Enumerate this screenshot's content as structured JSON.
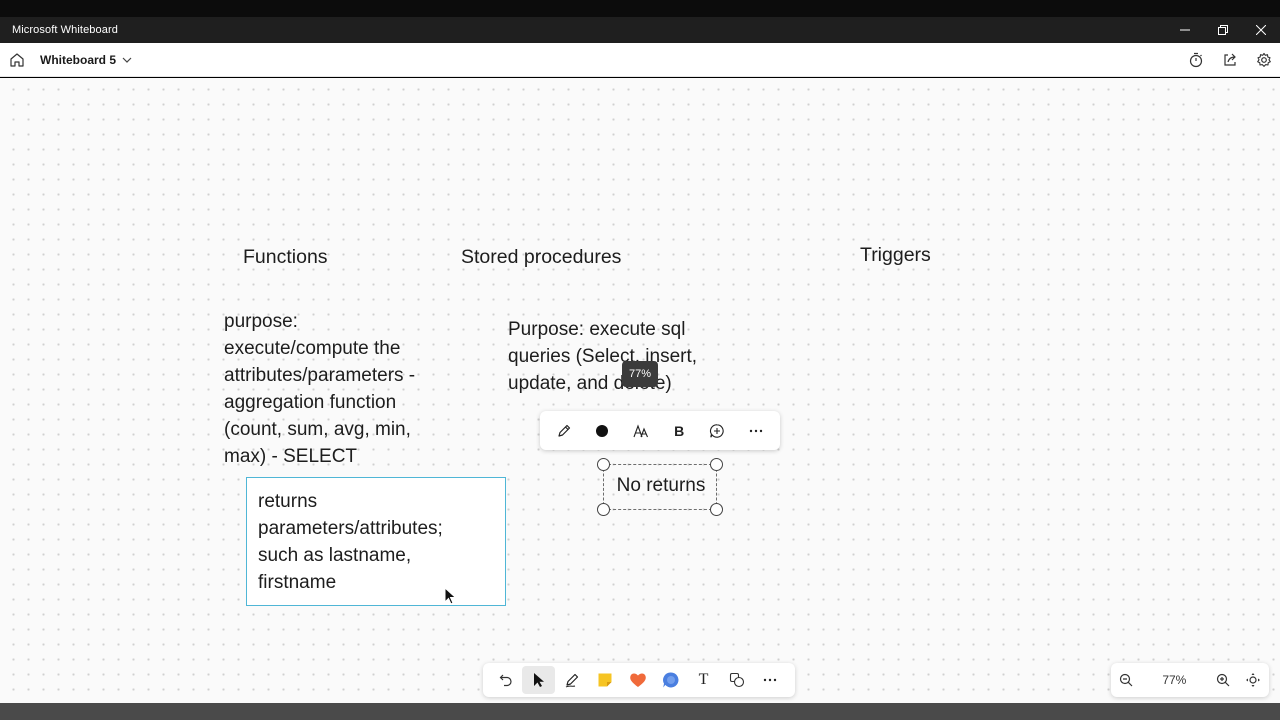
{
  "window": {
    "title": "Microsoft Whiteboard"
  },
  "appbar": {
    "board_name": "Whiteboard 5",
    "icons": [
      "home-icon",
      "chevron-down-icon",
      "timer-icon",
      "share-icon",
      "settings-icon"
    ]
  },
  "canvas": {
    "headings": {
      "functions": "Functions",
      "stored_procedures": "Stored procedures",
      "triggers": "Triggers"
    },
    "functions_purpose": [
      "purpose:",
      "execute/compute the",
      "attributes/parameters -",
      "aggregation function",
      "(count, sum, avg, min,",
      "max) - SELECT"
    ],
    "functions_returns": [
      "returns",
      "parameters/attributes;",
      "such as lastname,",
      "firstname"
    ],
    "sp_purpose": [
      "Purpose: execute sql",
      "queries (Select, insert,",
      "update, and delete)"
    ],
    "selected_note": "No returns",
    "zoom_tooltip": "77%"
  },
  "context_toolbar": {
    "items": [
      "pen-icon",
      "color-dot-icon",
      "font-size-icon",
      "bold-icon",
      "add-comment-icon",
      "more-icon"
    ],
    "bold_label": "B"
  },
  "bottom_toolbar": {
    "items": [
      "undo-icon",
      "select-icon",
      "pen-icon",
      "sticky-note-icon",
      "reaction-icon",
      "comment-icon",
      "text-icon",
      "shapes-icon",
      "more-icon"
    ],
    "text_label": "T"
  },
  "zoom": {
    "level": "77%"
  },
  "colors": {
    "accent": "#4fb6d6",
    "titlebar": "#1f1f1f"
  }
}
